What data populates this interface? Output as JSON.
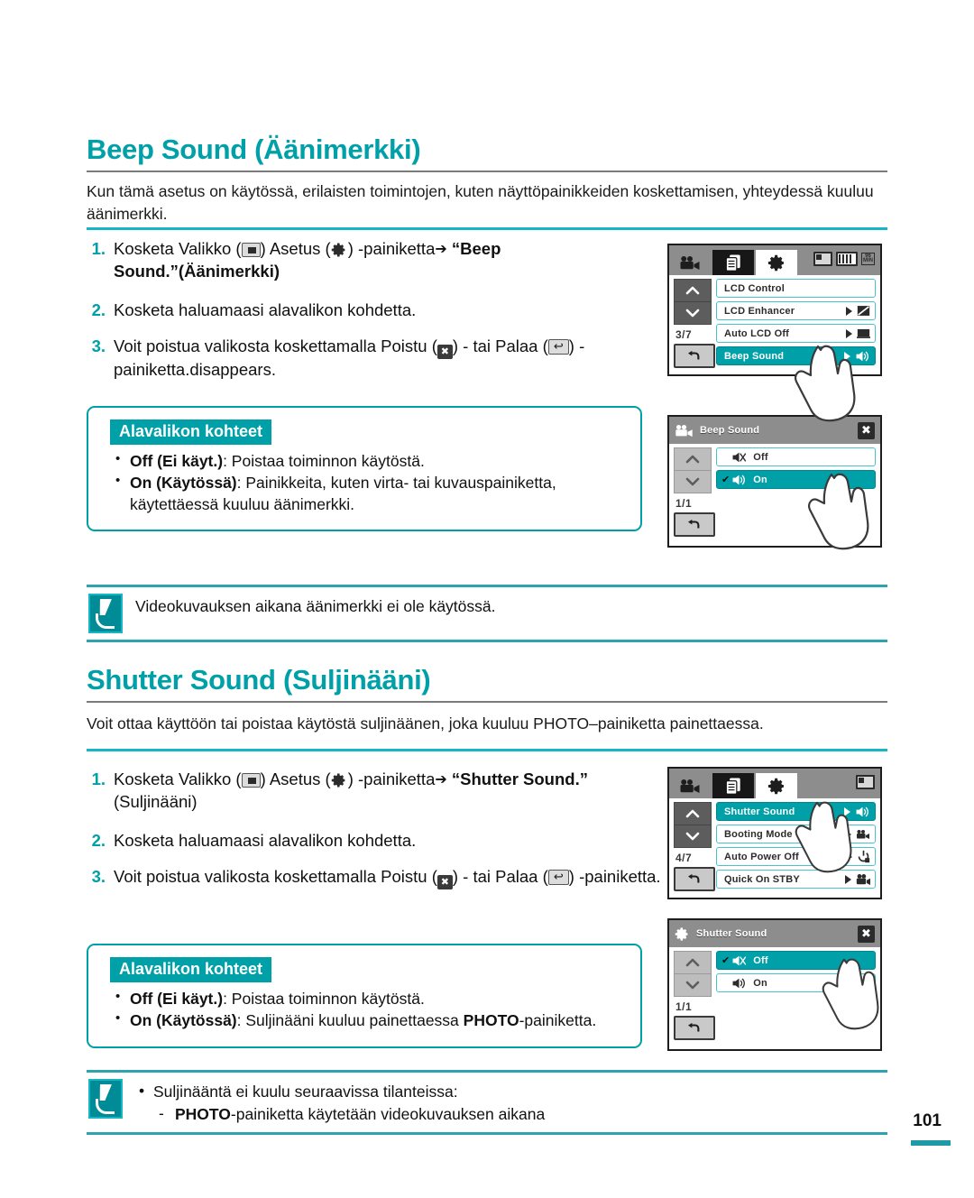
{
  "page_number": "101",
  "colors": {
    "teal": "#00a0a8",
    "light_teal": "#17b6c4",
    "rule_gray": "#7a7a7a"
  },
  "sections": [
    {
      "title": "Beep Sound (Äänimerkki)",
      "description": "Kun tämä asetus on käytössä, erilaisten toimintojen, kuten näyttöpainikkeiden koskettamisen, yhteydessä kuuluu äänimerkki.",
      "steps": [
        {
          "num": "1.",
          "parts": [
            {
              "t": "Kosketa Valikko ("
            },
            {
              "icon": "menu-icon"
            },
            {
              "t": ") Asetus ("
            },
            {
              "icon": "gear-icon"
            },
            {
              "t": ") -painiketta"
            },
            {
              "icon": "right-arrow-icon"
            },
            {
              "t": " "
            },
            {
              "t": "“Beep Sound.”(Äänimerkki)",
              "bold": true
            }
          ]
        },
        {
          "num": "2.",
          "parts": [
            {
              "t": "Kosketa haluamaasi alavalikon kohdetta."
            }
          ]
        },
        {
          "num": "3.",
          "parts": [
            {
              "t": "Voit poistua valikosta koskettamalla Poistu ("
            },
            {
              "icon": "exit-icon"
            },
            {
              "t": ") - tai Palaa ("
            },
            {
              "icon": "return-icon"
            },
            {
              "t": ") -painiketta.disappears."
            }
          ]
        }
      ],
      "submenu": {
        "tag": "Alavalikon kohteet",
        "items": [
          {
            "bold": "Off (Ei käyt.)",
            "rest": ": Poistaa toiminnon käytöstä."
          },
          {
            "bold": "On (Käytössä)",
            "rest": ": Painikkeita, kuten virta- tai kuvauspainiketta, käytettäessä kuuluu äänimerkki."
          }
        ]
      },
      "note": {
        "lines": [
          {
            "text": "Videokuvauksen aikana äänimerkki ei ole käytössä.",
            "level": 0,
            "bullet": false
          }
        ]
      }
    },
    {
      "title": "Shutter Sound (Suljinääni)",
      "description": "Voit ottaa käyttöön tai poistaa käytöstä suljinäänen, joka kuuluu PHOTO–painiketta painettaessa.",
      "steps": [
        {
          "num": "1.",
          "parts": [
            {
              "t": "Kosketa Valikko ("
            },
            {
              "icon": "menu-icon"
            },
            {
              "t": ") Asetus ("
            },
            {
              "icon": "gear-icon"
            },
            {
              "t": ") -painiketta"
            },
            {
              "icon": "right-arrow-icon"
            },
            {
              "t": " "
            },
            {
              "t": "“Shutter Sound.”",
              "bold": true
            },
            {
              "t": " (Suljinääni)"
            }
          ]
        },
        {
          "num": "2.",
          "parts": [
            {
              "t": "Kosketa haluamaasi alavalikon kohdetta."
            }
          ]
        },
        {
          "num": "3.",
          "parts": [
            {
              "t": "Voit poistua valikosta koskettamalla Poistu ("
            },
            {
              "icon": "exit-icon"
            },
            {
              "t": ") - tai Palaa ("
            },
            {
              "icon": "return-icon"
            },
            {
              "t": ") -painiketta."
            }
          ]
        }
      ],
      "submenu": {
        "tag": "Alavalikon kohteet",
        "items": [
          {
            "bold": "Off (Ei käyt.)",
            "rest": ": Poistaa toiminnon käytöstä."
          },
          {
            "bold": "On (Käytössä)",
            "rest": ": Suljinääni kuuluu painettaessa PHOTO-painiketta."
          }
        ]
      },
      "note": {
        "lines": [
          {
            "text": "Suljinääntä ei kuulu seuraavissa tilanteissa:",
            "level": 0,
            "bullet": true
          },
          {
            "text": "PHOTO-painiketta käytetään videokuvauksen aikana",
            "level": 1,
            "bullet": false
          }
        ]
      }
    }
  ],
  "lcd_screens": [
    {
      "id": "beep-menu",
      "type": "tabbed-menu",
      "tabs": [
        "camcorder-icon",
        "playback-icon",
        "settings-gear-icon"
      ],
      "active_tab_index": 2,
      "status": {
        "card": "card-icon",
        "battery": "battery-icon",
        "time": "96 MIN"
      },
      "page_indicator": "3/7",
      "rows": [
        {
          "label": "LCD Control",
          "selected": false,
          "has_arrow": false,
          "value_icon": ""
        },
        {
          "label": "LCD Enhancer",
          "selected": false,
          "has_arrow": true,
          "value_icon": "enhancer-icon"
        },
        {
          "label": "Auto LCD Off",
          "selected": false,
          "has_arrow": true,
          "value_icon": "lcd-off-icon"
        },
        {
          "label": "Beep Sound",
          "selected": true,
          "has_arrow": true,
          "value_icon": "speaker-icon"
        }
      ]
    },
    {
      "id": "beep-dialog",
      "type": "dialog",
      "title_icon": "camcorder-icon",
      "title": "Beep Sound",
      "close": "✖",
      "page_indicator": "1/1",
      "rows": [
        {
          "label": "Off",
          "selected": false,
          "checked": false,
          "value_icon": "speaker-mute-icon"
        },
        {
          "label": "On",
          "selected": true,
          "checked": true,
          "value_icon": "speaker-icon"
        }
      ]
    },
    {
      "id": "shutter-menu",
      "type": "tabbed-menu",
      "tabs": [
        "camcorder-icon",
        "playback-icon",
        "settings-gear-icon"
      ],
      "active_tab_index": 2,
      "status": {
        "card": "card-icon",
        "battery": "",
        "time": ""
      },
      "page_indicator": "4/7",
      "rows": [
        {
          "label": "Shutter Sound",
          "selected": true,
          "has_arrow": true,
          "value_icon": "speaker-icon"
        },
        {
          "label": "Booting Mode",
          "selected": false,
          "has_arrow": true,
          "value_icon": "camcorder-icon"
        },
        {
          "label": "Auto Power Off",
          "selected": false,
          "has_arrow": true,
          "value_icon": "power-off-icon"
        },
        {
          "label": "Quick On STBY",
          "selected": false,
          "has_arrow": true,
          "value_icon": "quickon-icon"
        }
      ]
    },
    {
      "id": "shutter-dialog",
      "type": "dialog",
      "title_icon": "settings-gear-icon",
      "title": "Shutter Sound",
      "close": "✖",
      "page_indicator": "1/1",
      "rows": [
        {
          "label": "Off",
          "selected": true,
          "checked": true,
          "value_icon": "speaker-mute-icon"
        },
        {
          "label": "On",
          "selected": false,
          "checked": false,
          "value_icon": "speaker-icon"
        }
      ]
    }
  ]
}
